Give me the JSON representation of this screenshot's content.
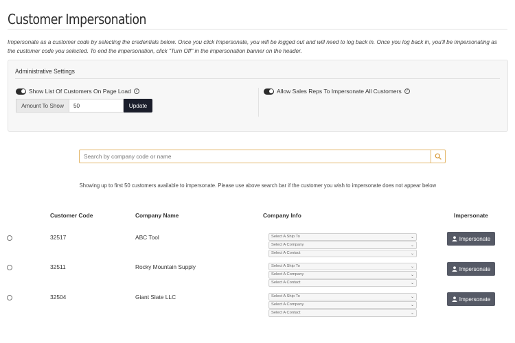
{
  "page": {
    "title": "Customer Impersonation",
    "intro": "Impersonate as a customer code by selecting the credentials below. Once you click Impersonate, you will be logged out and will need to log back in. Once you log back in, you'll be impersonating as the customer code you selected. To end the impersonation, click \"Turn Off\" in the impersonation banner on the header."
  },
  "admin": {
    "title": "Administrative Settings",
    "show_list_label": "Show List Of Customers On Page Load",
    "amount_label": "Amount To Show",
    "amount_value": "50",
    "update_label": "Update",
    "allow_reps_label": "Allow Sales Reps To Impersonate All Customers"
  },
  "search": {
    "placeholder": "Search by company code or name"
  },
  "showing_note": "Showing up to first 50 customers available to impersonate. Please use above search bar if the customer you wish to impersonate does not appear below",
  "table": {
    "headers": [
      "Customer Code",
      "Company Name",
      "Company Info",
      "Impersonate"
    ],
    "select_placeholders": [
      "Select A Ship To",
      "Select A Company",
      "Select A Contact"
    ],
    "impersonate_label": "Impersonate",
    "rows": [
      {
        "code": "32517",
        "company": "ABC Tool"
      },
      {
        "code": "32511",
        "company": "Rocky Mountain Supply"
      },
      {
        "code": "32504",
        "company": "Giant Slate LLC"
      }
    ]
  },
  "icons": [
    "help-icon",
    "search-icon",
    "user-icon",
    "chevron-down-icon"
  ]
}
